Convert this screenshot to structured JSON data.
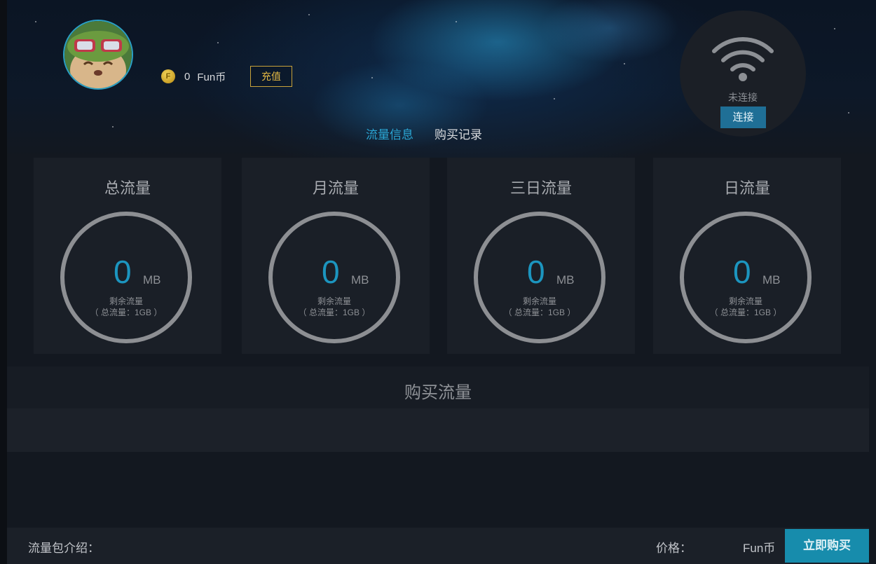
{
  "user": {
    "coin_symbol": "F",
    "coin_amount": "0",
    "coin_unit": "Fun币",
    "recharge_label": "充值"
  },
  "tabs": [
    {
      "label": "流量信息",
      "active": true
    },
    {
      "label": "购买记录",
      "active": false
    }
  ],
  "wifi": {
    "status": "未连接",
    "connect_label": "连接"
  },
  "stats": [
    {
      "title": "总流量",
      "value": "0",
      "unit": "MB",
      "sub": "剩余流量",
      "total": "（ 总流量：1GB ）"
    },
    {
      "title": "月流量",
      "value": "0",
      "unit": "MB",
      "sub": "剩余流量",
      "total": "（ 总流量：1GB ）"
    },
    {
      "title": "三日流量",
      "value": "0",
      "unit": "MB",
      "sub": "剩余流量",
      "total": "（ 总流量：1GB ）"
    },
    {
      "title": "日流量",
      "value": "0",
      "unit": "MB",
      "sub": "剩余流量",
      "total": "（ 总流量：1GB ）"
    }
  ],
  "purchase": {
    "title": "购买流量"
  },
  "footer": {
    "intro_label": "流量包介绍：",
    "price_label": "价格：",
    "price_unit": "Fun币",
    "buy_now_label": "立即购买"
  },
  "colors": {
    "accent": "#2aa6d4",
    "value_blue": "#1c95bf",
    "recharge_gold": "#c8a23a",
    "buy_button": "#178cac",
    "ring_gray": "#8d8f93"
  }
}
